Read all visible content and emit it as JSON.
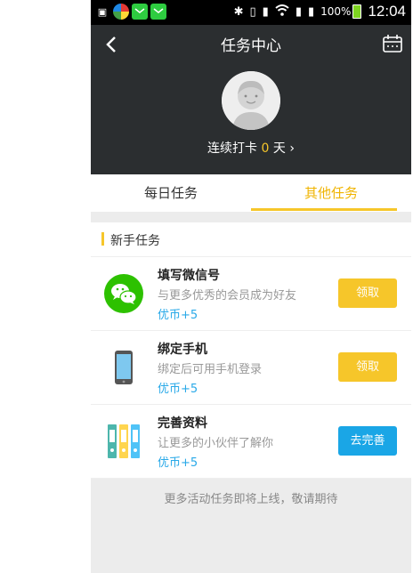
{
  "status_bar": {
    "battery": "100%",
    "time": "12:04"
  },
  "header": {
    "title": "任务中心",
    "checkin_prefix": "连续打卡",
    "checkin_days": "0",
    "checkin_suffix": "天",
    "checkin_arrow": "›"
  },
  "tabs": [
    {
      "label": "每日任务",
      "active": false
    },
    {
      "label": "其他任务",
      "active": true
    }
  ],
  "section": {
    "title": "新手任务"
  },
  "tasks": [
    {
      "name": "填写微信号",
      "desc": "与更多优秀的会员成为好友",
      "reward": "优币+5",
      "button": "领取",
      "icon": "wechat-icon"
    },
    {
      "name": "绑定手机",
      "desc": "绑定后可用手机登录",
      "reward": "优币+5",
      "button": "领取",
      "icon": "phone-icon"
    },
    {
      "name": "完善资料",
      "desc": "让更多的小伙伴了解你",
      "reward": "优币+5",
      "button": "去完善",
      "icon": "binders-icon"
    }
  ],
  "footer_note": "更多活动任务即将上线，敬请期待",
  "colors": {
    "accent": "#f6c62a",
    "link": "#29a9e8",
    "button_blue": "#1aa6e6",
    "header_bg": "#2b2e30"
  }
}
